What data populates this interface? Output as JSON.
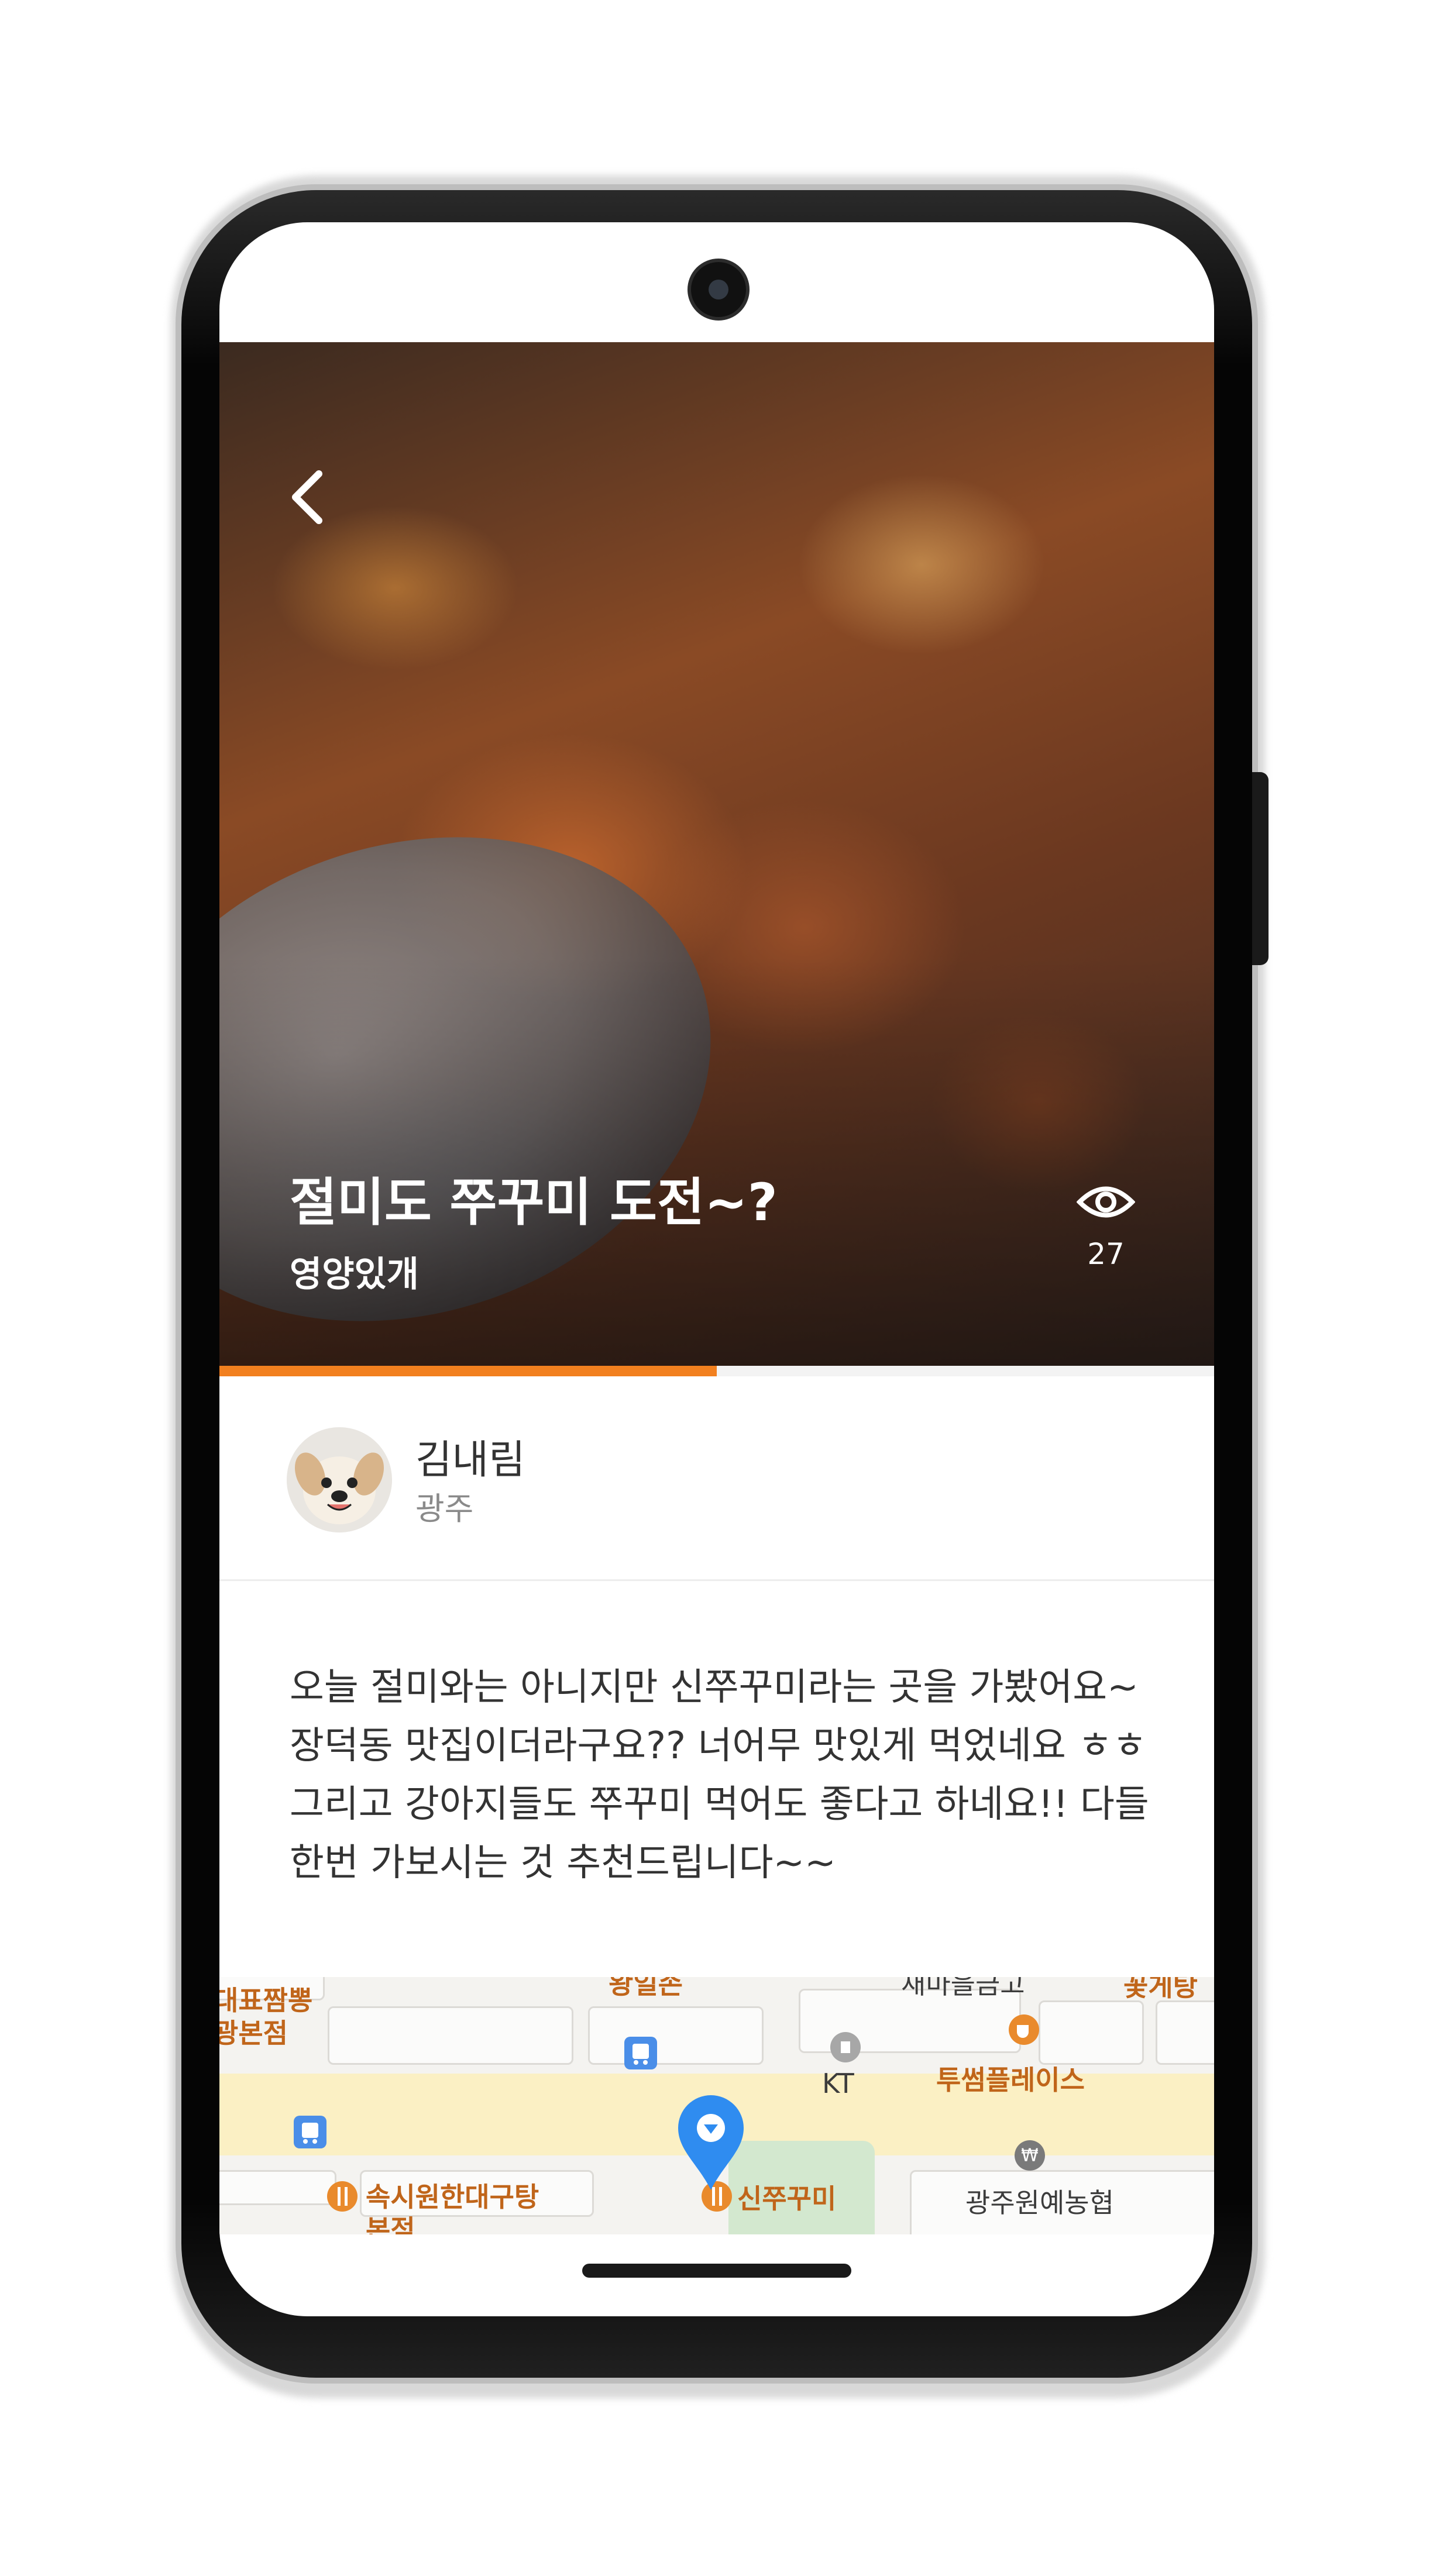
{
  "post": {
    "title": "절미도 쭈꾸미 도전~?",
    "category": "영양있개",
    "view_count": "27",
    "story_progress_percent": 50
  },
  "author": {
    "name": "김내림",
    "region": "광주"
  },
  "body": {
    "text": "오늘 절미와는 아니지만 신쭈꾸미라는 곳을 가봤어요~ 장덕동 맛집이더라구요?? 너어무 맛있게 먹었네요 ㅎㅎ 그리고 강아지들도 쭈꾸미 먹어도 좋다고 하네요!! 다들 한번 가보시는 것 추천드립니다~~"
  },
  "map": {
    "labels": {
      "top_left": "대표짬뽕",
      "top_left_sub": "광본점",
      "top_center": "왕일손",
      "top_right_a": "새마을금고",
      "top_right_b": "꽃게탕",
      "kt": "KT",
      "twosome": "투썸플레이스",
      "restaurant_left": "속시원한대구탕",
      "restaurant_left_sub": "본점",
      "destination": "신쭈꾸미",
      "bank": "광주원예농협"
    }
  },
  "colors": {
    "accent_orange": "#f2801f",
    "map_label_orange": "#c0651a",
    "pin_blue": "#2f8cf0"
  }
}
